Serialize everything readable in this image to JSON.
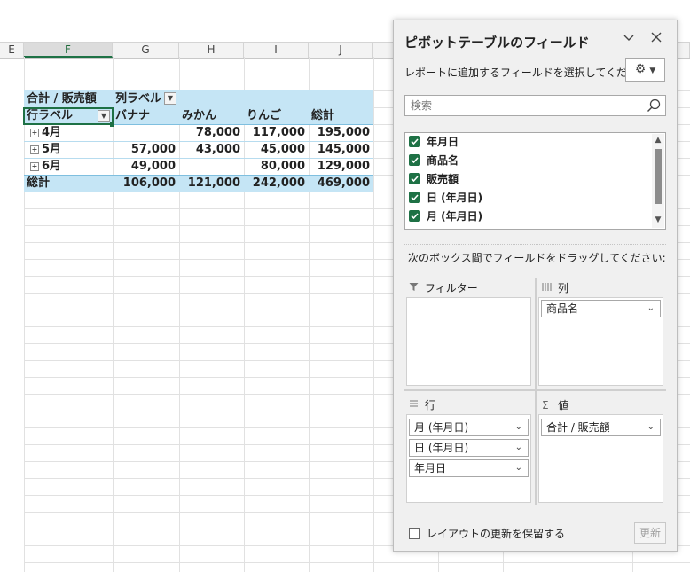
{
  "sheet": {
    "columns": [
      "E",
      "F",
      "G",
      "H",
      "I",
      "J"
    ],
    "pivot": {
      "header": {
        "value_label": "合計 / 販売額",
        "col_label": "列ラベル"
      },
      "row_label": "行ラベル",
      "columns": [
        "バナナ",
        "みかん",
        "りんご",
        "総計"
      ],
      "rows": [
        {
          "label": "4月",
          "values": [
            "",
            "78,000",
            "117,000",
            "195,000"
          ]
        },
        {
          "label": "5月",
          "values": [
            "57,000",
            "43,000",
            "45,000",
            "145,000"
          ]
        },
        {
          "label": "6月",
          "values": [
            "49,000",
            "",
            "80,000",
            "129,000"
          ]
        }
      ],
      "total": {
        "label": "総計",
        "values": [
          "106,000",
          "121,000",
          "242,000",
          "469,000"
        ]
      }
    }
  },
  "panel": {
    "title": "ピボットテーブルのフィールド",
    "choose_label": "レポートに追加するフィールドを選択してください:",
    "search_placeholder": "検索",
    "fields": [
      {
        "label": "年月日",
        "checked": true
      },
      {
        "label": "商品名",
        "checked": true
      },
      {
        "label": "販売額",
        "checked": true
      },
      {
        "label": "日 (年月日)",
        "checked": true
      },
      {
        "label": "月 (年月日)",
        "checked": true
      }
    ],
    "drag_label": "次のボックス間でフィールドをドラッグしてください:",
    "areas": {
      "filter": {
        "label": "フィルター",
        "items": []
      },
      "columns": {
        "label": "列",
        "items": [
          "商品名"
        ]
      },
      "rows": {
        "label": "行",
        "items": [
          "月 (年月日)",
          "日 (年月日)",
          "年月日"
        ]
      },
      "values": {
        "label": "値",
        "items": [
          "合計 / 販売額"
        ]
      }
    },
    "defer_label": "レイアウトの更新を保留する",
    "update_label": "更新"
  },
  "icons": {
    "chevron_down": "chevron-down-icon",
    "close": "close-icon",
    "gear": "gear-icon",
    "search": "search-icon",
    "filter": "filter-icon",
    "columns": "columns-icon",
    "rows": "rows-icon",
    "sigma": "sigma-icon"
  },
  "colors": {
    "accent": "#1e7145",
    "pivot_band": "#c5e5f5"
  }
}
